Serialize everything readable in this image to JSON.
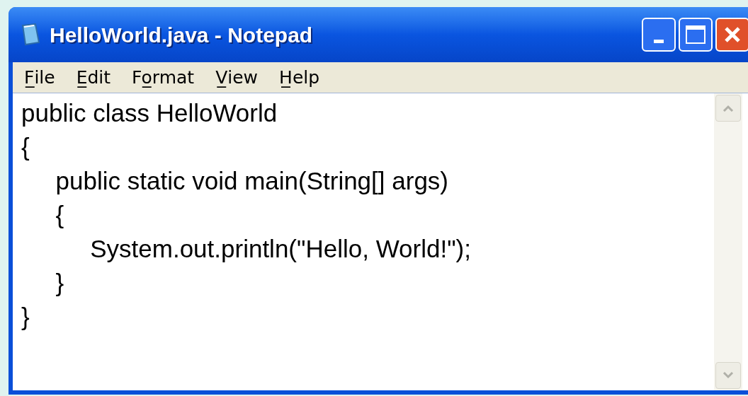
{
  "window": {
    "title": "HelloWorld.java - Notepad"
  },
  "menu": [
    {
      "label": "F̲ile"
    },
    {
      "label": "E̲dit"
    },
    {
      "label": "Fo̲rmat"
    },
    {
      "label": "V̲iew"
    },
    {
      "label": "H̲elp"
    }
  ],
  "editor": {
    "lines": [
      "public class HelloWorld",
      "{",
      "     public static void main(String[] args)",
      "     {",
      "          System.out.println(\"Hello, World!\");",
      "     }",
      "}"
    ]
  }
}
